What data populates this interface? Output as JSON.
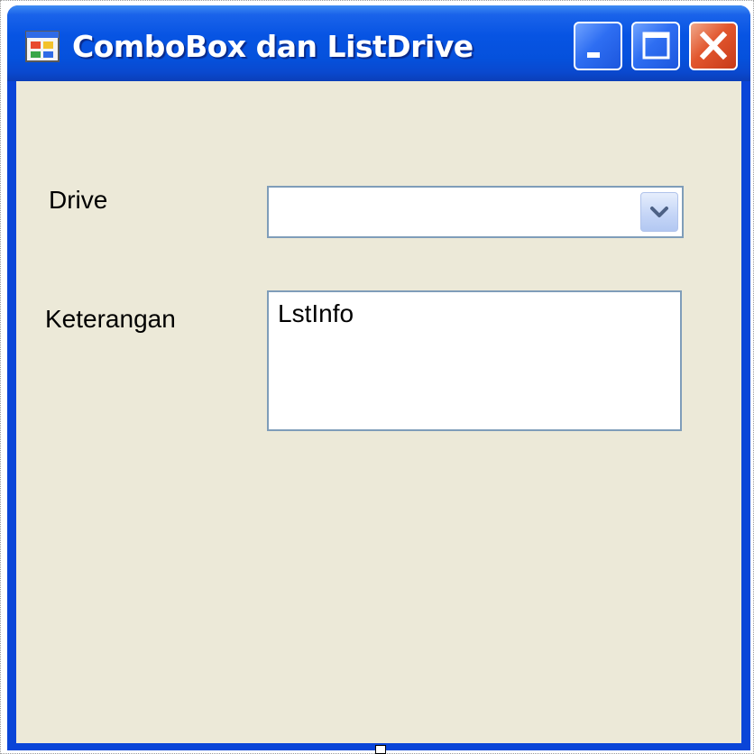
{
  "window": {
    "title": "ComboBox dan ListDrive",
    "icon": "form-icon",
    "buttons": {
      "minimize_icon": "minimize-icon",
      "maximize_icon": "maximize-icon",
      "close_icon": "close-icon"
    }
  },
  "form": {
    "drive_label": "Drive",
    "drive_combo": {
      "value": "",
      "dropdown_icon": "chevron-down-icon"
    },
    "keterangan_label": "Keterangan",
    "info_list": {
      "items": [
        "LstInfo"
      ]
    }
  },
  "colors": {
    "titlebar": "#0754e3",
    "client_bg": "#ece9d8",
    "control_border": "#7f9db9",
    "close_button": "#e2562e"
  }
}
